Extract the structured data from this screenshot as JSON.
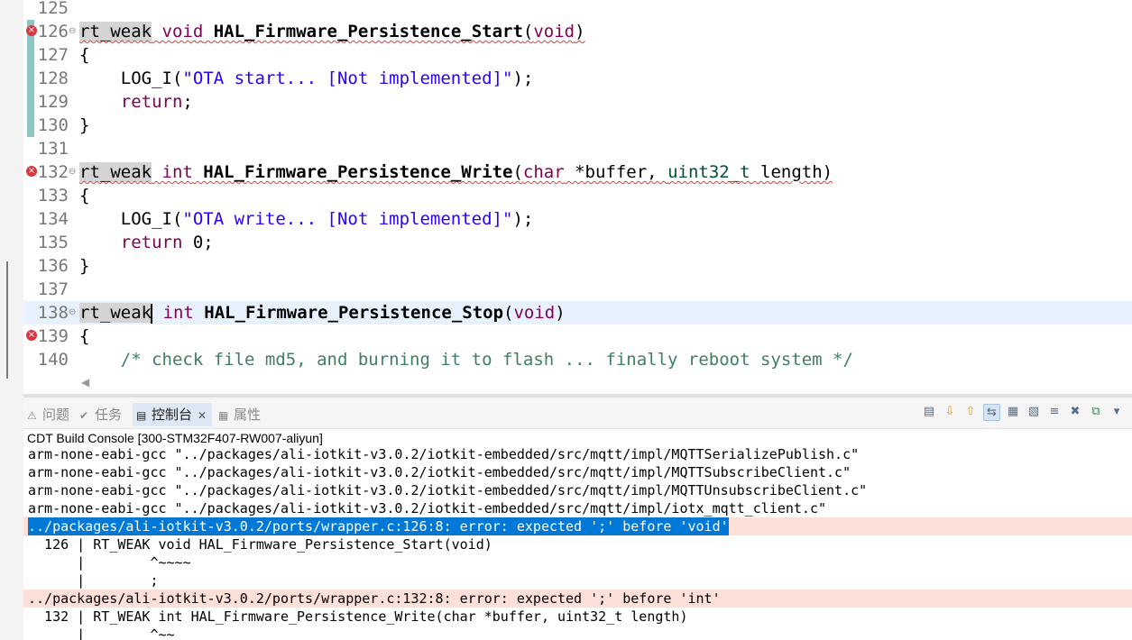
{
  "editor": {
    "lines": [
      {
        "num": "125",
        "parts": []
      },
      {
        "num": "126",
        "error": true,
        "changed": true,
        "fold": true,
        "squiggle": true,
        "parts": [
          [
            "macro",
            "rt_weak"
          ],
          [
            "",
            ""
          ],
          [
            "kw",
            " void"
          ],
          [
            "fn",
            " HAL_Firmware_Persistence_Start"
          ],
          [
            "",
            "("
          ],
          [
            "kw",
            "void"
          ],
          [
            "",
            ")"
          ]
        ]
      },
      {
        "num": "127",
        "changed": true,
        "parts": [
          [
            "",
            "{"
          ]
        ]
      },
      {
        "num": "128",
        "changed": true,
        "parts": [
          [
            "",
            "    LOG_I("
          ],
          [
            "str",
            "\"OTA start... [Not implemented]\""
          ],
          [
            "",
            ");"
          ]
        ]
      },
      {
        "num": "129",
        "changed": true,
        "parts": [
          [
            "kw",
            "    return"
          ],
          [
            "",
            ";"
          ]
        ]
      },
      {
        "num": "130",
        "changed": true,
        "parts": [
          [
            "",
            "}"
          ]
        ]
      },
      {
        "num": "131",
        "parts": []
      },
      {
        "num": "132",
        "error": true,
        "fold": true,
        "squiggle": true,
        "parts": [
          [
            "macro",
            "rt_weak"
          ],
          [
            "kw",
            " int"
          ],
          [
            "fn",
            " HAL_Firmware_Persistence_Write"
          ],
          [
            "",
            "("
          ],
          [
            "kw",
            "char"
          ],
          [
            "",
            " *buffer, "
          ],
          [
            "typ",
            "uint32_t"
          ],
          [
            "",
            " length)"
          ]
        ]
      },
      {
        "num": "133",
        "parts": [
          [
            "",
            "{"
          ]
        ]
      },
      {
        "num": "134",
        "parts": [
          [
            "",
            "    LOG_I("
          ],
          [
            "str",
            "\"OTA write... [Not implemented]\""
          ],
          [
            "",
            ");"
          ]
        ]
      },
      {
        "num": "135",
        "parts": [
          [
            "kw",
            "    return"
          ],
          [
            "",
            " 0;"
          ]
        ]
      },
      {
        "num": "136",
        "parts": [
          [
            "",
            "}"
          ]
        ]
      },
      {
        "num": "137",
        "parts": []
      },
      {
        "num": "138",
        "current": true,
        "fold": true,
        "caret": true,
        "parts": [
          [
            "macro",
            "rt_weak"
          ],
          [
            "kw",
            " int"
          ],
          [
            "fn",
            " HAL_Firmware_Persistence_Stop"
          ],
          [
            "",
            "("
          ],
          [
            "kw",
            "void"
          ],
          [
            "",
            ")"
          ]
        ]
      },
      {
        "num": "139",
        "error": true,
        "parts": [
          [
            "",
            "{"
          ]
        ]
      },
      {
        "num": "140",
        "parts": [
          [
            "cmt",
            "    /* check file md5, and burning it to flash ... finally reboot system */"
          ]
        ]
      }
    ]
  },
  "tabs": [
    {
      "label": "问题",
      "icon": "problems-icon",
      "active": false
    },
    {
      "label": "任务",
      "icon": "tasks-icon",
      "active": false
    },
    {
      "label": "控制台",
      "icon": "console-icon",
      "active": true,
      "close": "✕"
    },
    {
      "label": "属性",
      "icon": "properties-icon",
      "active": false
    }
  ],
  "toolbar": [
    "clear-console-icon",
    "scroll-lock-icon",
    "pin-icon",
    "word-wrap-icon",
    "open-console-icon",
    "display-selected-icon",
    "show-console-icon",
    "terminate-icon",
    "new-console-icon",
    "view-menu-icon"
  ],
  "console": {
    "title": "CDT Build Console [300-STM32F407-RW007-aliyun]",
    "lines": [
      {
        "text": "arm-none-eabi-gcc \"../packages/ali-iotkit-v3.0.2/iotkit-embedded/src/mqtt/impl/MQTTSerializePublish.c\""
      },
      {
        "text": "arm-none-eabi-gcc \"../packages/ali-iotkit-v3.0.2/iotkit-embedded/src/mqtt/impl/MQTTSubscribeClient.c\""
      },
      {
        "text": "arm-none-eabi-gcc \"../packages/ali-iotkit-v3.0.2/iotkit-embedded/src/mqtt/impl/MQTTUnsubscribeClient.c\""
      },
      {
        "text": "arm-none-eabi-gcc \"../packages/ali-iotkit-v3.0.2/iotkit-embedded/src/mqtt/impl/iotx_mqtt_client.c\""
      },
      {
        "text": "../packages/ali-iotkit-v3.0.2/ports/wrapper.c:126:8: error: expected ';' before 'void'",
        "error": true,
        "selected": true
      },
      {
        "text": "  126 | RT_WEAK void HAL_Firmware_Persistence_Start(void)"
      },
      {
        "text": "      |        ^~~~~"
      },
      {
        "text": "      |        ;"
      },
      {
        "text": "../packages/ali-iotkit-v3.0.2/ports/wrapper.c:132:8: error: expected ';' before 'int'",
        "error": true
      },
      {
        "text": "  132 | RT_WEAK int HAL_Firmware_Persistence_Write(char *buffer, uint32_t length)"
      },
      {
        "text": "      |        ^~~"
      }
    ]
  }
}
